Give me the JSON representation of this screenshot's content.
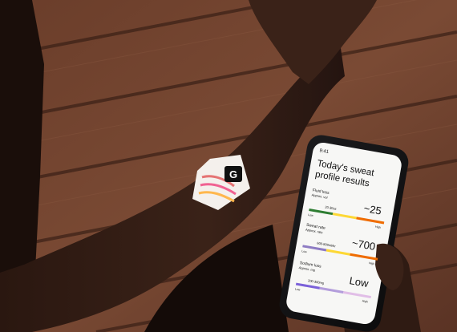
{
  "phone": {
    "status_time": "9:41",
    "title_line1": "Today's sweat",
    "title_line2": "profile results",
    "metrics": [
      {
        "name": "Fluid loss",
        "sub": "Approx. vol",
        "value": "~25",
        "range": "20-30oz",
        "scale_low": "Low",
        "scale_high": "High",
        "colors": [
          "#2e7d32",
          "#fdd835",
          "#ef6c00"
        ]
      },
      {
        "name": "Sweat rate",
        "sub": "Approx. rate",
        "value": "~700",
        "range": "600-800ml/hr",
        "scale_low": "Low",
        "scale_high": "High",
        "colors": [
          "#8e7cc3",
          "#fdd835",
          "#ef6c00"
        ]
      },
      {
        "name": "Sodium loss",
        "sub": "Approx. mg",
        "value": "Low",
        "range": "200-300mg",
        "scale_low": "Low",
        "scale_high": "High",
        "colors": [
          "#7b61d9",
          "#b39ddb",
          "#e1bee7"
        ]
      }
    ]
  },
  "patch": {
    "logo_text": "G"
  }
}
